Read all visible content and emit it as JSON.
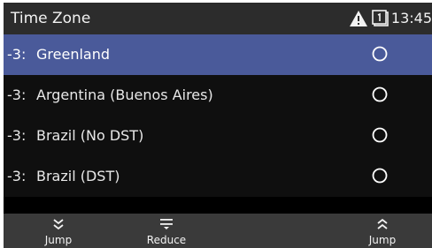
{
  "header": {
    "title": "Time Zone",
    "icons": [
      "warning-icon",
      "line-status-icon"
    ],
    "clock": "13:45"
  },
  "list": {
    "items": [
      {
        "offset": "-3:",
        "label": "Greenland",
        "selected": true
      },
      {
        "offset": "-3:",
        "label": "Argentina (Buenos Aires)",
        "selected": false
      },
      {
        "offset": "-3:",
        "label": "Brazil (No DST)",
        "selected": false
      },
      {
        "offset": "-3:",
        "label": "Brazil (DST)",
        "selected": false
      }
    ]
  },
  "softkeys": [
    {
      "icon": "double-chevron-down-icon",
      "label": "Jump"
    },
    {
      "icon": "reduce-icon",
      "label": "Reduce"
    },
    {
      "icon": "double-chevron-up-icon",
      "label": "Jump"
    }
  ],
  "colors": {
    "selected_row": "#4a5a9a",
    "title_bar": "#2c2c2c",
    "softkey_bar": "#3a3a3a",
    "background": "#000000"
  }
}
